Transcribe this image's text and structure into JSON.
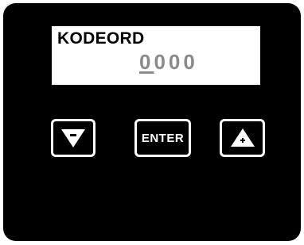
{
  "display": {
    "label": "KODEORD",
    "value_cursor_digit": "0",
    "value_rest": "000"
  },
  "keys": {
    "down_icon": "triangle-down-minus-icon",
    "enter_label": "ENTER",
    "up_icon": "triangle-up-plus-icon"
  },
  "colors": {
    "panel": "#000000",
    "display_background": "#ffffff",
    "display_value": "#8a8a8a",
    "key_border": "#ffffff"
  }
}
